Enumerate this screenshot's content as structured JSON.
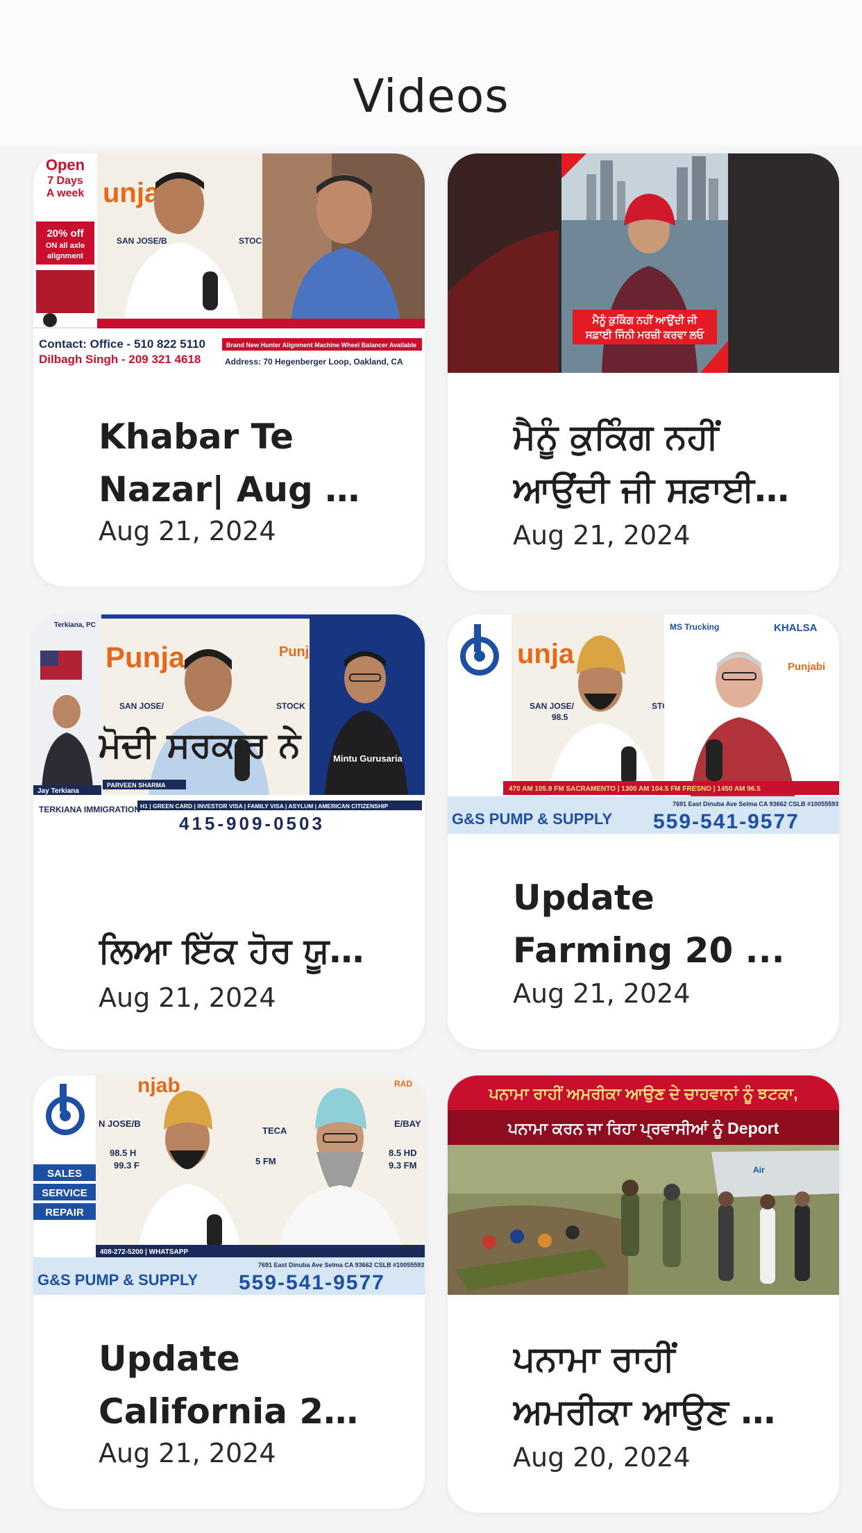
{
  "page": {
    "title": "Videos"
  },
  "videos": [
    {
      "title_line1": "Khabar Te",
      "title_line2": "Nazar| Aug 2...",
      "date": "Aug 21, 2024",
      "thumb": {
        "open_line1": "Open",
        "open_line2": "7 Days",
        "open_line3": "A week",
        "promo": "20% off",
        "promo2": "ON all axle",
        "promo3": "alignment",
        "brand": "unja",
        "contact_line1": "Contact: Office - 510 822 5110",
        "contact_line2": "Dilbagh Singh - 209 321 4618",
        "address": "Address: 70 Hegenberger Loop, Oakland, CA",
        "banner": "Brand New Hunter Alignment Machine Wheel Balancer Available",
        "station": "SAN JOSE/B",
        "stock": "STOC"
      }
    },
    {
      "title_line1": "ਮੈਨੂੰ ਕੁਕਿੰਗ ਨਹੀਂ",
      "title_line2": "ਆਉਂਦੀ ਜੀ ਸਫ਼ਾਈ ...",
      "date": "Aug 21, 2024",
      "thumb": {
        "caption1": "ਮੈਨੂੰ ਕੁਕਿੰਗ ਨਹੀਂ ਆਉਂਦੀ ਜੀ",
        "caption2": "ਸਫ਼ਾਈ ਜਿੰਨੀ ਮਰਜ਼ੀ ਕਰਵਾ ਲਓ"
      }
    },
    {
      "title_line1": "ਮੋਦੀ ਸਰਕਾਰ ਨੇ",
      "title_line2": "ਲਿਆ ਇੱਕ ਹੋਰ ਯੂ-...",
      "date": "Aug 21, 2024",
      "thumb": {
        "brand": "Punja",
        "brand_small": "Punj",
        "station": "SAN JOSE/",
        "stock": "STOCK",
        "host_left": "PARVEEN SHARMA",
        "guest": "Mintu Gurusaria",
        "firm": "Terkiana, PC",
        "lawyer": "Jay Terkiana",
        "immigration": "TERKIANA IMMIGRATION",
        "services": "H1 | GREEN CARD | INVESTOR VISA | FAMILY VISA | ASYLUM | AMERICAN CITIZENSHIP",
        "phone": "415-909-0503"
      }
    },
    {
      "title_line1": "Update",
      "title_line2": "Farming 20 ...",
      "date": "Aug 21, 2024",
      "thumb": {
        "brand": "unja",
        "station": "SAN JOSE/",
        "freq": "98.5",
        "stock": "STOC",
        "sponsor1": "MS Trucking",
        "sponsor2": "KHALSA",
        "sponsor3": "Punjabi",
        "ticker": "470 AM 105.9 FM SACRAMENTO | 1300 AM 104.5 FM FRESNO | 1450 AM 96.5",
        "company": "G&S PUMP & SUPPLY",
        "address": "7691 East Dinuba Ave Selma CA 93662 CSLB #10055593",
        "phone": "559-541-9577"
      }
    },
    {
      "title_line1": "Update",
      "title_line2": "California 20...",
      "date": "Aug 21, 2024",
      "thumb": {
        "brand": "njab",
        "radio": "RAD",
        "station_left": "N JOSE/B",
        "freq_left1": "98.5 H",
        "freq_left2": "99.3 F",
        "station_mid": "TECA",
        "freq_mid": "5 FM",
        "station_right": "E/BAY",
        "freq_right1": "8.5 HD",
        "freq_right2": "9.3 FM",
        "sales1": "SALES",
        "sales2": "SERVICE",
        "sales3": "REPAIR",
        "ticker": "408-272-5200 | WHATSAPP",
        "company": "G&S PUMP & SUPPLY",
        "address": "7691 East Dinuba Ave Selma CA 93662 CSLB #10055593",
        "phone": "559-541-9577"
      }
    },
    {
      "title_line1": "ਪਨਾਮਾ ਰਾਹੀਂ",
      "title_line2": "ਅਮਰੀਕਾ ਆਉਣ ਦੇ ...",
      "date": "Aug 20, 2024",
      "thumb": {
        "headline1": "ਪਨਾਮਾ ਰਾਹੀਂ ਅਮਰੀਕਾ ਆਉਣ ਦੇ ਚਾਹਵਾਨਾਂ ਨੂੰ ਝਟਕਾ,",
        "headline2": "ਪਨਾਮਾ ਕਰਨ ਜਾ ਰਿਹਾ ਪ੍ਰਵਾਸੀਆਂ ਨੂੰ Deport"
      }
    }
  ]
}
